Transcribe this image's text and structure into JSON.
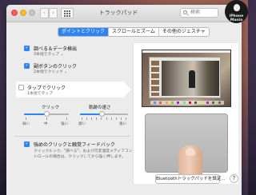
{
  "window": {
    "title": "トラックパッド",
    "search_placeholder": "検索",
    "nav_back": "‹",
    "nav_forward": "›"
  },
  "tabs": [
    {
      "label": "ポイントとクリック",
      "active": true
    },
    {
      "label": "スクロールとズーム",
      "active": false
    },
    {
      "label": "その他のジェスチャ",
      "active": false
    }
  ],
  "options": [
    {
      "label": "調べる＆データ検出",
      "sub": "3本指でタップ ⌄",
      "checked": true
    },
    {
      "label": "副ボタンのクリック",
      "sub": "2本指でクリック ⌄",
      "checked": true
    },
    {
      "label": "タップでクリック",
      "sub": "1本指でタップ",
      "checked": false
    }
  ],
  "click_slider": {
    "label": "クリック",
    "tick_labels": [
      "弱い",
      "中",
      "強い"
    ],
    "value_fraction": 0.5
  },
  "speed_slider": {
    "label": "軌跡の速さ",
    "tick_labels": [
      "遅い",
      "速い"
    ],
    "value_fraction": 0.45
  },
  "silent_click": {
    "label": "強めのクリックと触覚フィードバック",
    "description_line1": "クイックルック、\"調べる\"、および可変速度メディアコン",
    "description_line2": "トロールの場合は、クリックしてから強く押します。",
    "checked": true
  },
  "bluetooth_button": "Bluetoothトラックパッドを設定...",
  "help_label": "?",
  "badge": {
    "text": "iPhone Mania"
  },
  "colors": {
    "accent": "#2d84f5",
    "close": "#fc5f57",
    "minimize": "#fdbc2e",
    "maximize": "#c7c7c7"
  },
  "icons": {
    "search": "search-icon",
    "grid": "grid-icon",
    "help": "help-icon",
    "checkmark": "checkmark-icon",
    "apple": "apple-logo-icon"
  },
  "checkmark_glyph": "✓"
}
